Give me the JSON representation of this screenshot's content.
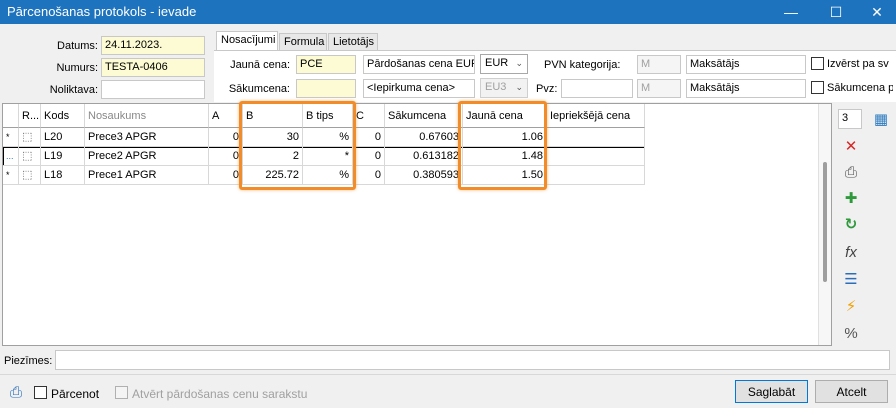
{
  "window": {
    "title": "Pārcenošanas protokols - ievade",
    "minimize": "—",
    "maximize": "☐",
    "close": "✕"
  },
  "header": {
    "date_label": "Datums:",
    "date_value": "24.11.2023.",
    "number_label": "Numurs:",
    "number_value": "TESTA-0406",
    "warehouse_label": "Noliktava:",
    "warehouse_value": ""
  },
  "tabs": [
    "Nosacījumi",
    "Formula",
    "Lietotājs"
  ],
  "settings": {
    "new_price_label": "Jaunā cena:",
    "new_price_value": "PCE",
    "start_price_label": "Sākumcena:",
    "start_price_value": "",
    "sale_price_text": "Pārdošanas cena EUR",
    "currency_value": "EUR",
    "purchase_price_text": "<Iepirkuma cena>",
    "eu3_value": "EU3",
    "vat_label": "PVN kategorija:",
    "vat_value": "M",
    "payer_text": "Maksātājs",
    "pvz_label": "Pvz:",
    "pvz_value": "",
    "pvz_code": "M",
    "payer_text2": "Maksātājs",
    "chk1_label": "Izvērst pa sv",
    "chk2_label": "Sākumcena p"
  },
  "grid": {
    "columns": [
      "R...",
      "Kods",
      "Nosaukums",
      "A",
      "B",
      "B tips",
      "C",
      "Sākumcena",
      "Jaunā cena",
      "Iepriekšējā cena"
    ],
    "rows": [
      {
        "marker": "*",
        "code": "L20",
        "name": "Prece3 APGR",
        "a": "0",
        "b": "30",
        "btype": "%",
        "c": "0",
        "start": "0.67603",
        "new": "1.06",
        "prev": ""
      },
      {
        "marker": "...",
        "code": "L19",
        "name": "Prece2 APGR",
        "a": "0",
        "b": "2",
        "btype": "*",
        "c": "0",
        "start": "0.613182",
        "new": "1.48",
        "prev": ""
      },
      {
        "marker": "*",
        "code": "L18",
        "name": "Prece1 APGR",
        "a": "0",
        "b": "225.72",
        "btype": "%",
        "c": "0",
        "start": "0.380593",
        "new": "1.50",
        "prev": ""
      }
    ]
  },
  "toolbar": {
    "count_value": "3",
    "calc_icon": "▦",
    "delete_icon": "✕",
    "print_icon": "⎙",
    "add_icon": "✚",
    "refresh_icon": "↻",
    "fx_icon": "fx",
    "list_icon": "☰",
    "lightning_icon": "⚡",
    "percent_icon": "%"
  },
  "footer": {
    "notes_label": "Piezīmes:",
    "notes_value": "",
    "reprice_label": "Pārcenot",
    "open_list_label": "Atvērt pārdošanas cenu sarakstu",
    "save_label": "Saglabāt",
    "cancel_label": "Atcelt"
  },
  "colors": {
    "titlebar": "#1e73be",
    "highlight": "#f28c28",
    "required": "#fdfbd3"
  }
}
